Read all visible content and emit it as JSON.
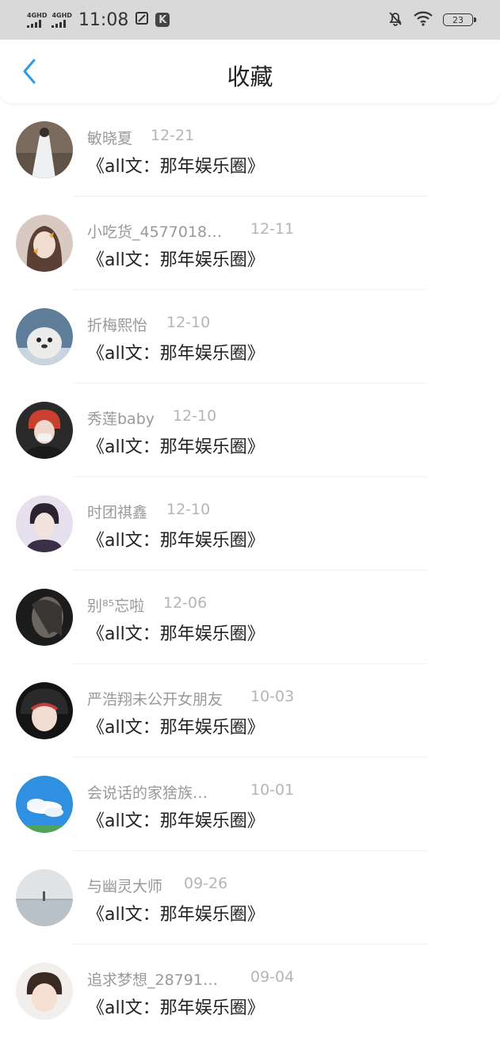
{
  "status_bar": {
    "network1": "4GHD",
    "network2": "4GHD",
    "time": "11:08",
    "k_icon": "K",
    "battery": "23",
    "icons": [
      "signal-icon",
      "signal-icon",
      "sim-icon",
      "k-app-icon",
      "mute-bell-icon",
      "wifi-icon",
      "battery-icon"
    ]
  },
  "header": {
    "title": "收藏",
    "back_icon": "chevron-left-icon",
    "accent": "#2b9be9"
  },
  "items": [
    {
      "user": "敏晓夏",
      "date": "12-21",
      "title": "《all文：那年娱乐圈》"
    },
    {
      "user": "小吃货_4577018…",
      "date": "12-11",
      "title": "《all文：那年娱乐圈》"
    },
    {
      "user": "折梅熙怡",
      "date": "12-10",
      "title": "《all文：那年娱乐圈》"
    },
    {
      "user": "秀莲baby",
      "date": "12-10",
      "title": "《all文：那年娱乐圈》"
    },
    {
      "user": "时团祺鑫",
      "date": "12-10",
      "title": "《all文：那年娱乐圈》"
    },
    {
      "user": "别⁸⁵忘啦",
      "date": "12-06",
      "title": "《all文：那年娱乐圈》"
    },
    {
      "user": "严浩翔未公开女朋友",
      "date": "10-03",
      "title": "《all文：那年娱乐圈》"
    },
    {
      "user": "会说话的家猞族…",
      "date": "10-01",
      "title": "《all文：那年娱乐圈》"
    },
    {
      "user": "与幽灵大师",
      "date": "09-26",
      "title": "《all文：那年娱乐圈》"
    },
    {
      "user": "追求梦想_28791…",
      "date": "09-04",
      "title": "《all文：那年娱乐圈》"
    }
  ]
}
